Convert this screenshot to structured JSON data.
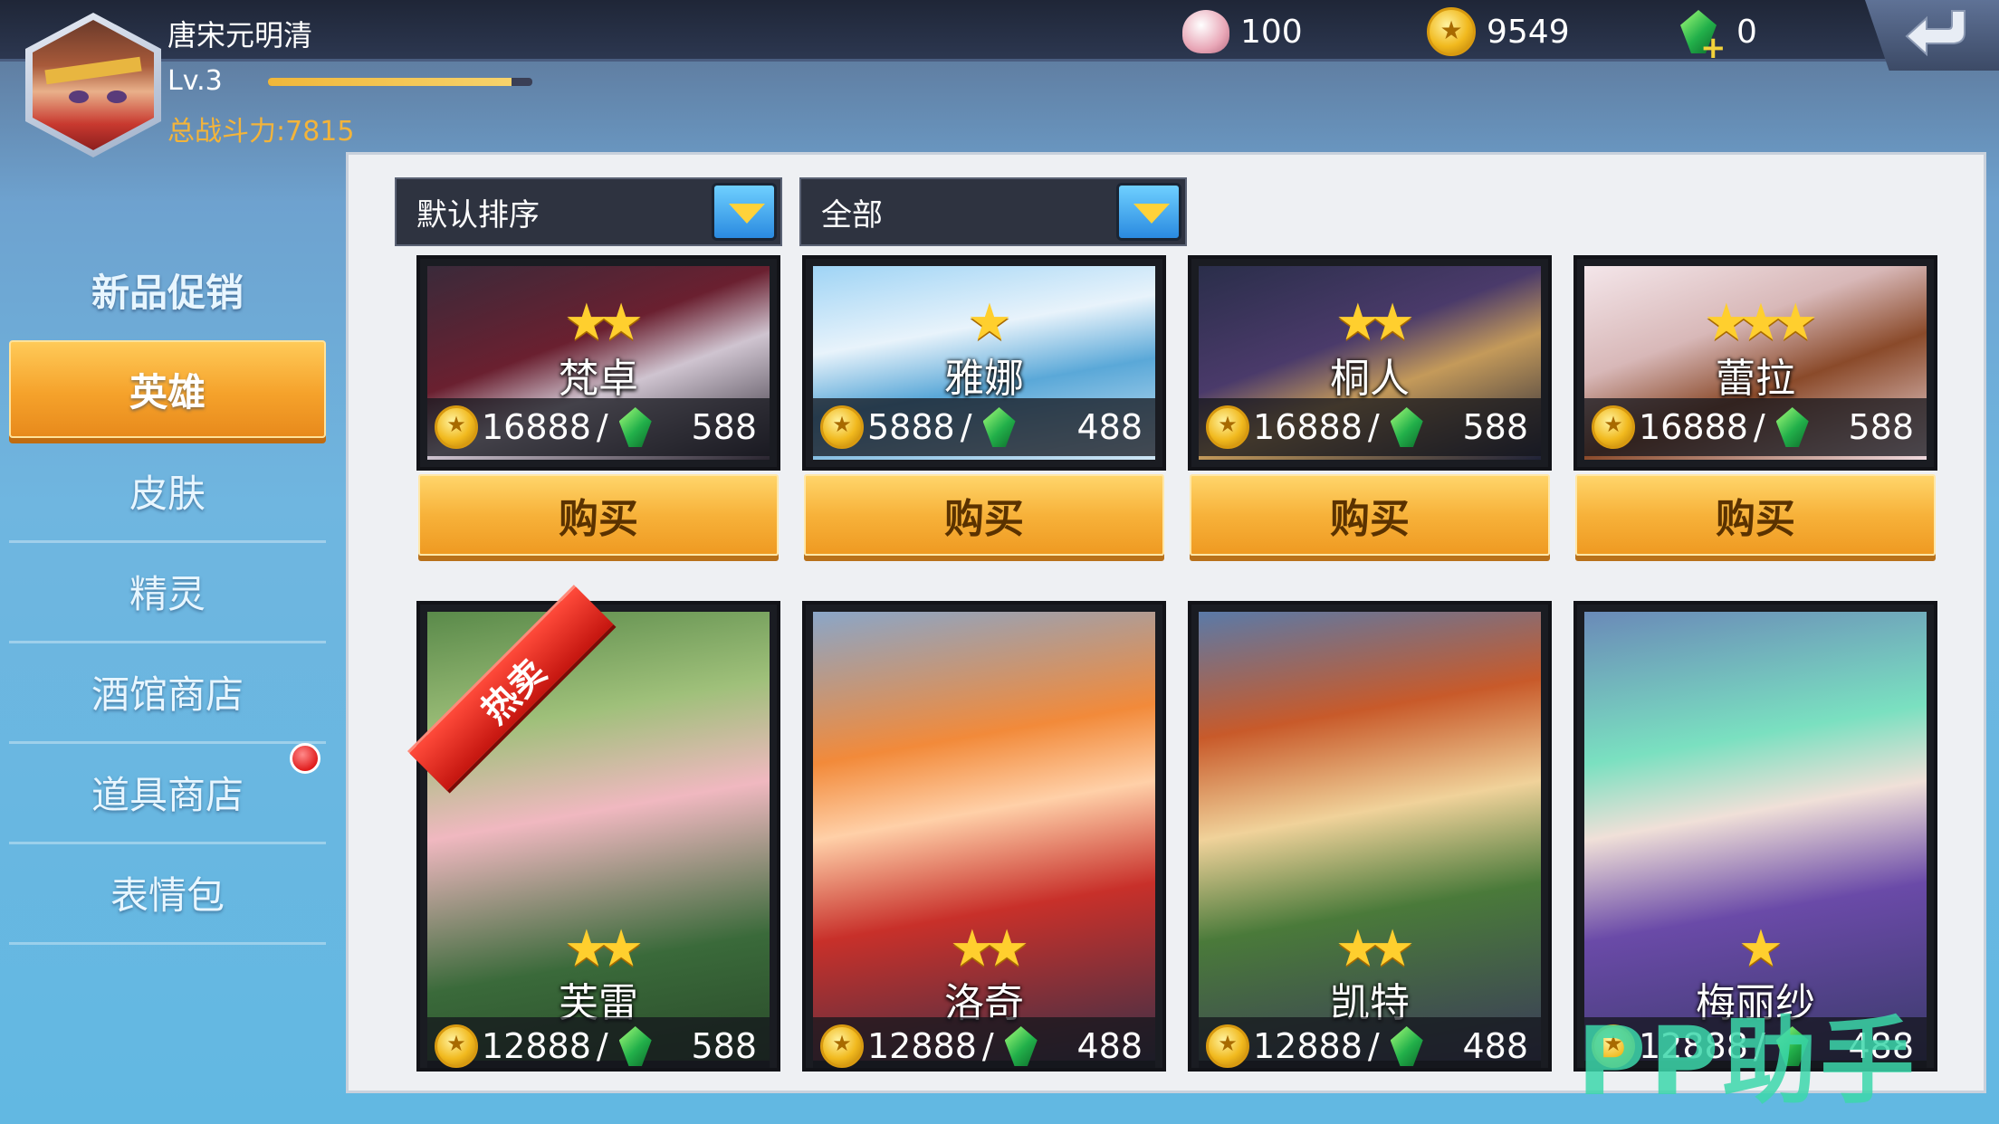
{
  "player": {
    "name": "唐宋元明清",
    "level": "Lv.3",
    "exp_progress": 0.92,
    "power": "总战斗力:7815"
  },
  "resources": {
    "shells": "100",
    "coins": "9549",
    "gems": "0"
  },
  "sidebar": {
    "title": "新品促销",
    "items": [
      {
        "label": "英雄",
        "active": true
      },
      {
        "label": "皮肤",
        "active": false
      },
      {
        "label": "精灵",
        "active": false
      },
      {
        "label": "酒馆商店",
        "active": false,
        "badge": true
      },
      {
        "label": "道具商店",
        "active": false
      },
      {
        "label": "表情包",
        "active": false
      }
    ]
  },
  "filters": {
    "sort": "默认排序",
    "category": "全部"
  },
  "buy_label": "购买",
  "hot_label": "热卖",
  "heroes_row1": [
    {
      "name": "梵卓",
      "stars": 2,
      "coin_price": "16888",
      "gem_price": "588"
    },
    {
      "name": "雅娜",
      "stars": 1,
      "coin_price": "5888",
      "gem_price": "488"
    },
    {
      "name": "桐人",
      "stars": 2,
      "coin_price": "16888",
      "gem_price": "588"
    },
    {
      "name": "蕾拉",
      "stars": 3,
      "coin_price": "16888",
      "gem_price": "588"
    }
  ],
  "heroes_row2": [
    {
      "name": "芙雷",
      "stars": 2,
      "coin_price": "12888",
      "gem_price": "588"
    },
    {
      "name": "洛奇",
      "stars": 2,
      "coin_price": "12888",
      "gem_price": "488"
    },
    {
      "name": "凯特",
      "stars": 2,
      "coin_price": "12888",
      "gem_price": "488"
    },
    {
      "name": "梅丽纱",
      "stars": 1,
      "coin_price": "12888",
      "gem_price": "488"
    }
  ],
  "price_separator": "/",
  "watermark": "PP助手",
  "colors": {
    "accent_orange": "#f5a22b",
    "panel_bg": "#eef0f3",
    "power_text": "#f3b43a",
    "hot_red": "#e0241c"
  }
}
